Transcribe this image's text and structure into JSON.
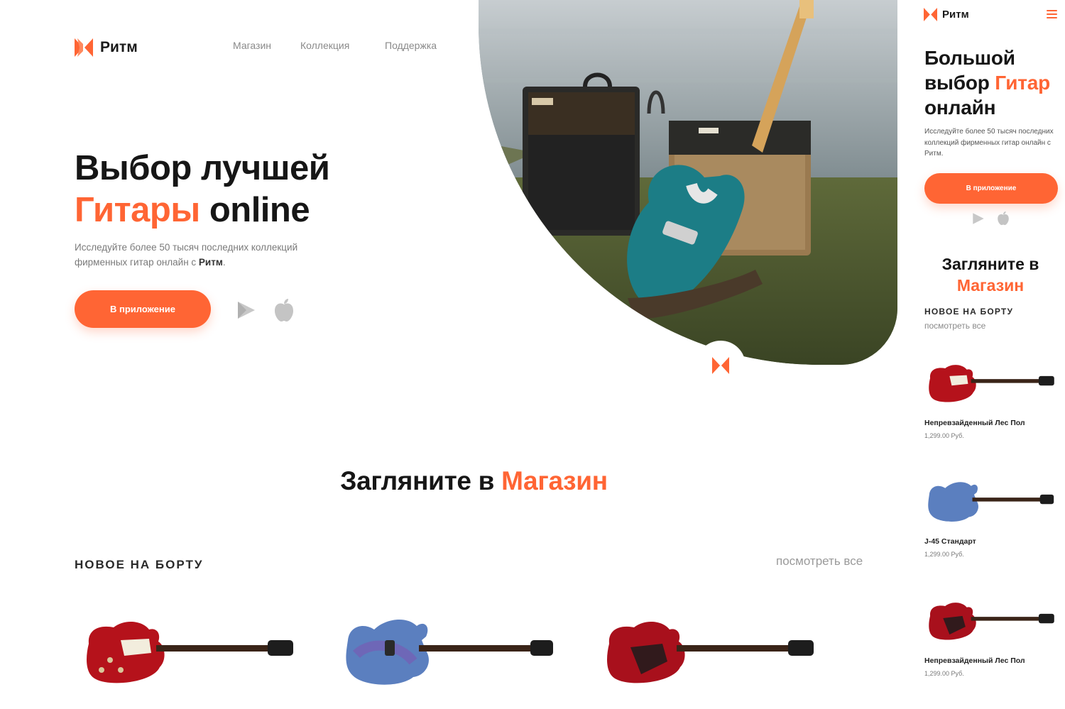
{
  "brand": {
    "name": "Ритм",
    "accent": "#FF6534"
  },
  "nav": {
    "items": [
      "Магазин",
      "Коллекция",
      "Поддержка"
    ]
  },
  "hero": {
    "line1": "Выбор лучшей",
    "line2_accent": "Гитары",
    "line2_rest": " online",
    "text_before": "Исследуйте более 50 тысяч последних коллекций фирменных гитар онлайн с ",
    "text_bold": "Ритм",
    "text_after": ".",
    "cta": "В приложение",
    "store_icons": [
      "play-store-icon",
      "apple-icon"
    ]
  },
  "shop": {
    "title_prefix": "Загляните в ",
    "title_accent": "Магазин",
    "new_label": "НОВОЕ НА БОРТУ",
    "view_all": "посмотреть все",
    "products": [
      {
        "name": "Непревзайденный Лес Пол",
        "price": "1,299.00 Руб.",
        "color": "#b5121b"
      },
      {
        "name": "J-45 Стандарт",
        "price": "1,299.00 Руб.",
        "color": "#4a78b8"
      },
      {
        "name": "Непревзайденный Лес Пол",
        "price": "1,299.00 Руб.",
        "color": "#a8101c"
      }
    ]
  },
  "mobile": {
    "title_line1": "Большой",
    "title_line2_prefix": "выбор ",
    "title_line2_accent": "Гитар",
    "title_line3": "онлайн",
    "text": "Исследуйте более 50 тысяч последних коллекций фирменных гитар онлайн с Ритм.",
    "cta": "В приложение",
    "shop_line1": "Загляните в",
    "shop_line2": "Магазин",
    "menu_icon": "hamburger-menu-icon"
  }
}
